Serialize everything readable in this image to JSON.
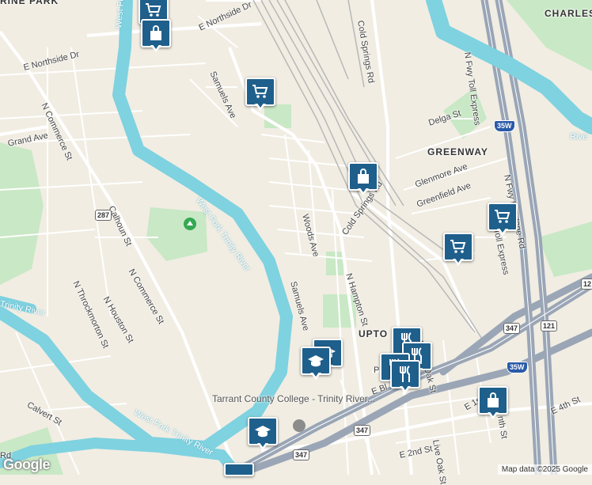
{
  "map": {
    "colors": {
      "land": "#f1ede3",
      "water": "#7fd2e0",
      "park": "#c9e8c5",
      "road": "#ffffff",
      "highway": "#9aa6b6",
      "rail": "#b8b8b8",
      "marker": "#1f5f8b"
    },
    "area_labels": [
      "RINE PARK",
      "CHARLES",
      "GREENWAY",
      "UPTO"
    ],
    "water_labels": [
      "West Fork",
      "West Fork Trinity River",
      "Trinity River",
      "West Fork Trinity River",
      "Rive"
    ],
    "street_labels": [
      "E Northside Dr",
      "E Northside Dr",
      "Samuels Ave",
      "N Commerce St",
      "Grand Ave",
      "Calhoun St",
      "N Commerce St",
      "N Throckmorton St",
      "N Houston St",
      "Calvert St",
      "Woods Ave",
      "Samuels Ave",
      "Cold Springs Rd",
      "Cold Springs Rd",
      "N Hampton St",
      "Delga St",
      "Glenmore Ave",
      "Greenfield Ave",
      "N Live Oak St",
      "Live Oak St",
      "N Fwy Toll Express",
      "N Fwy Frontage Rd",
      "N Fwy Toll Express",
      "E 4th St",
      "E 2nd St",
      "E 1s",
      "E Bl",
      "P",
      "nth St",
      "Rd"
    ],
    "shields": [
      "287",
      "347",
      "347",
      "347",
      "121",
      "35W",
      "35W",
      "12"
    ],
    "place_labels": {
      "college": "Tarrant County College - Trinity River..."
    },
    "markers": [
      {
        "type": "shopping-cart-icon"
      },
      {
        "type": "shopping-bag-icon"
      },
      {
        "type": "shopping-cart-icon"
      },
      {
        "type": "shopping-bag-icon"
      },
      {
        "type": "shopping-cart-icon"
      },
      {
        "type": "shopping-cart-icon"
      },
      {
        "type": "school-icon"
      },
      {
        "type": "school-icon"
      },
      {
        "type": "restaurant-icon"
      },
      {
        "type": "restaurant-icon"
      },
      {
        "type": "restaurant-icon"
      },
      {
        "type": "restaurant-icon"
      },
      {
        "type": "shopping-bag-icon"
      },
      {
        "type": "school-icon"
      }
    ],
    "attribution": "Map data ©2025 Google",
    "logo": "Google"
  }
}
